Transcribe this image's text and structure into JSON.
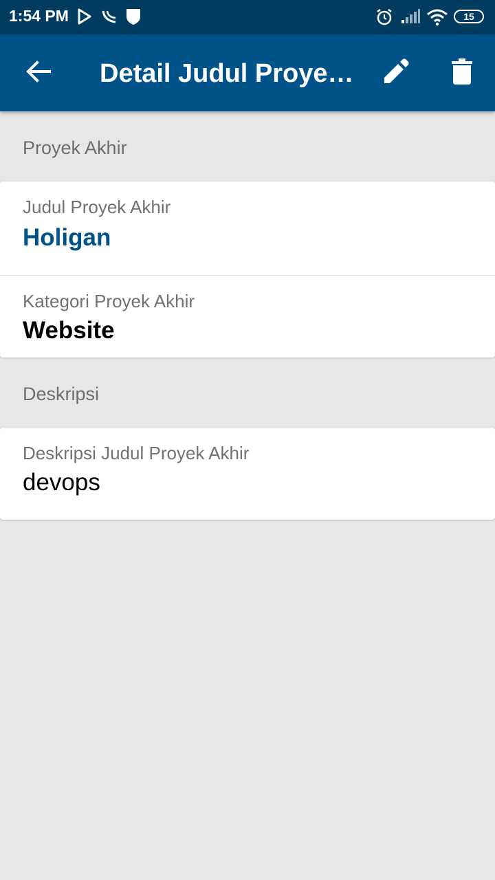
{
  "status_bar": {
    "time": "1:54 PM",
    "battery_level": "15",
    "left_icons": [
      "play-store-icon",
      "wifi-calling-icon",
      "shield-icon"
    ],
    "right_icons": [
      "alarm-icon",
      "signal-icon",
      "wifi-icon",
      "battery-icon"
    ]
  },
  "app_bar": {
    "title": "Detail Judul Proye…",
    "icons": [
      "back-arrow-icon",
      "edit-pencil-icon",
      "delete-trash-icon"
    ]
  },
  "sections": {
    "proyek_header": "Proyek Akhir",
    "judul_label": "Judul Proyek Akhir",
    "judul_value": "Holigan",
    "kategori_label": "Kategori Proyek Akhir",
    "kategori_value": "Website",
    "deskripsi_header": "Deskripsi",
    "deskripsi_label": "Deskripsi Judul Proyek Akhir",
    "deskripsi_value": "devops"
  },
  "colors": {
    "status_bar": "#003c5f",
    "app_bar": "#005389",
    "accent_text": "#005389",
    "background": "#e8e7e8"
  }
}
